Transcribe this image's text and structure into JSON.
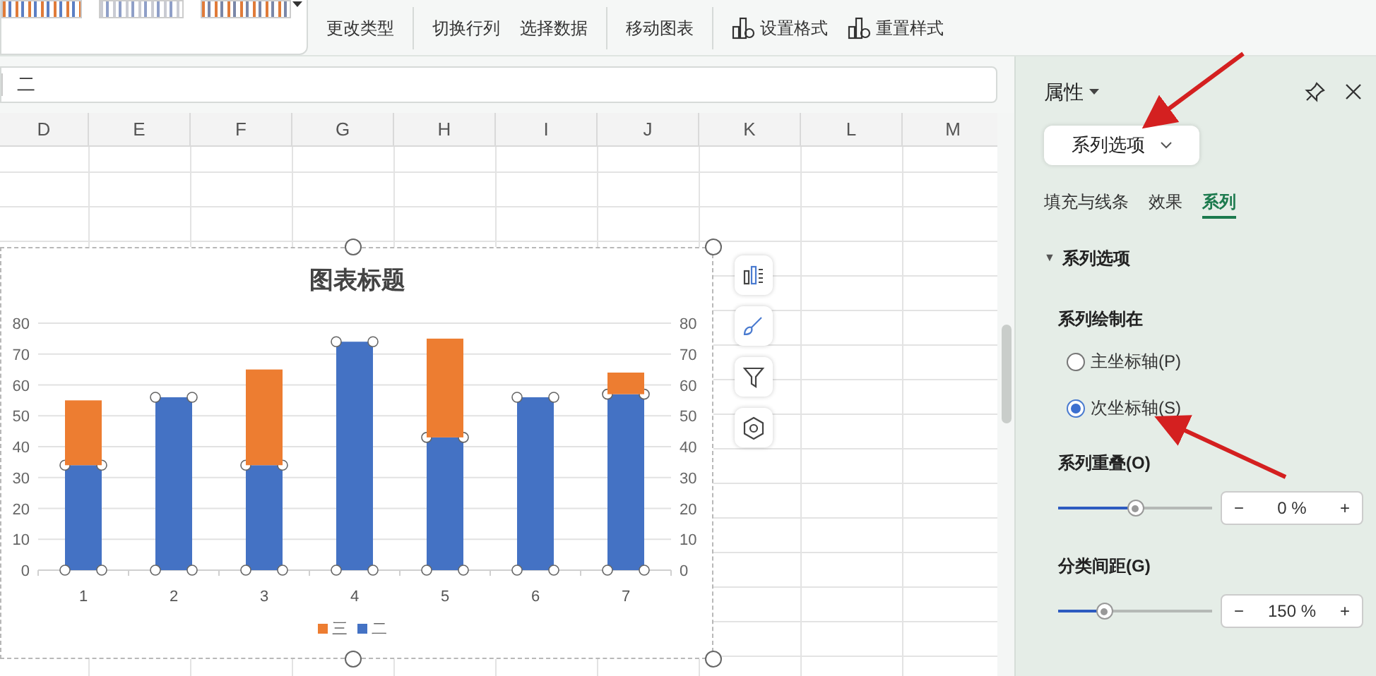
{
  "ribbon": {
    "button_groups": [
      {
        "buttons": [
          {
            "label": "更改类型",
            "icon": false
          }
        ]
      },
      {
        "buttons": [
          {
            "label": "切换行列",
            "icon": false
          },
          {
            "label": "选择数据",
            "icon": false
          }
        ]
      },
      {
        "buttons": [
          {
            "label": "移动图表",
            "icon": false
          }
        ]
      },
      {
        "buttons": [
          {
            "label": "设置格式",
            "icon": true
          },
          {
            "label": "重置样式",
            "icon": true
          }
        ]
      }
    ]
  },
  "formula_bar": {
    "value": "二"
  },
  "column_headers": [
    "D",
    "E",
    "F",
    "G",
    "H",
    "I",
    "J",
    "K",
    "L",
    "M"
  ],
  "chart": {
    "chart_data": {
      "type": "bar",
      "title": "图表标题",
      "categories": [
        "1",
        "2",
        "3",
        "4",
        "5",
        "6",
        "7"
      ],
      "series": [
        {
          "name": "三",
          "color": "#ed7d31",
          "values": [
            21,
            null,
            31,
            null,
            32,
            null,
            7
          ]
        },
        {
          "name": "二",
          "color": "#4472c4",
          "values": [
            34,
            56,
            34,
            74,
            43,
            56,
            57
          ]
        }
      ],
      "stacked": true,
      "grid": true,
      "legend": "bottom",
      "ylim": [
        0,
        80
      ],
      "yticks": [
        0,
        10,
        20,
        30,
        40,
        50,
        60,
        70,
        80
      ],
      "y2lim": [
        0,
        80
      ],
      "y2ticks": [
        0,
        10,
        20,
        30,
        40,
        50,
        60,
        70,
        80
      ]
    }
  },
  "panel": {
    "title": "属性",
    "dropdown": "系列选项",
    "tabs": [
      {
        "label": "填充与线条",
        "selected": false
      },
      {
        "label": "效果",
        "selected": false
      },
      {
        "label": "系列",
        "selected": true
      }
    ],
    "section": {
      "title": "系列选项",
      "expanded": true,
      "expander": "▼"
    },
    "plot_on": {
      "label": "系列绘制在",
      "options": [
        {
          "label": "主坐标轴(P)",
          "selected": false
        },
        {
          "label": "次坐标轴(S)",
          "selected": true
        }
      ]
    },
    "sliders": [
      {
        "label": "系列重叠(O)",
        "level": 0.5,
        "minus": "−",
        "value": "0",
        "unit": "%",
        "plus": "+"
      },
      {
        "label": "分类间距(G)",
        "level": 0.3,
        "minus": "−",
        "value": "150",
        "unit": "%",
        "plus": "+"
      }
    ]
  }
}
